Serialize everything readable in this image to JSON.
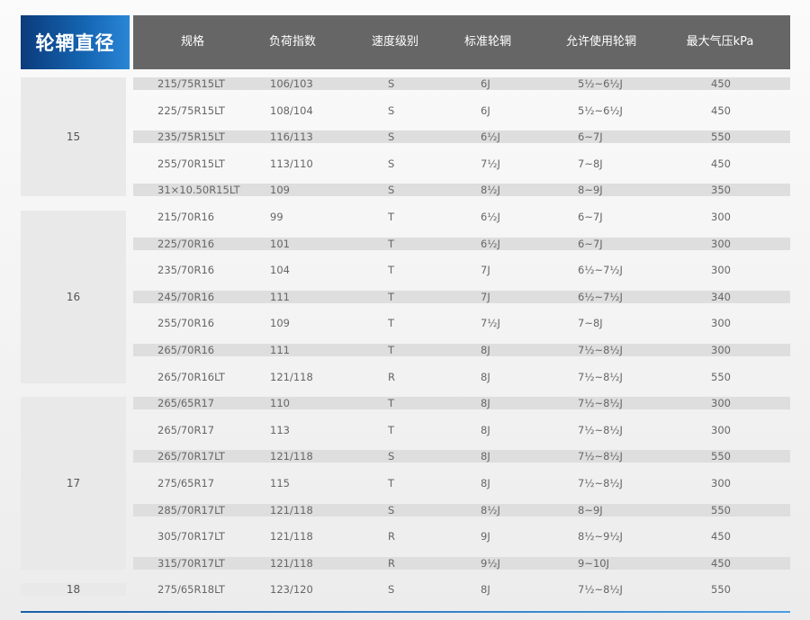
{
  "title": "轮辋直径",
  "headers": [
    "规格",
    "负荷指数",
    "速度级别",
    "标准轮辋",
    "允许使用轮辋",
    "最大气压kPa"
  ],
  "groups": [
    {
      "label": "15",
      "rows": 5
    },
    {
      "label": "16",
      "rows": 7
    },
    {
      "label": "17",
      "rows": 7
    },
    {
      "label": "18",
      "rows": 1
    }
  ],
  "rows": [
    [
      "215/75R15LT",
      "106/103",
      "S",
      "6J",
      "5½~6½J",
      "450"
    ],
    [
      "225/75R15LT",
      "108/104",
      "S",
      "6J",
      "5½~6½J",
      "450"
    ],
    [
      "235/75R15LT",
      "116/113",
      "S",
      "6½J",
      "6~7J",
      "550"
    ],
    [
      "255/70R15LT",
      "113/110",
      "S",
      "7½J",
      "7~8J",
      "450"
    ],
    [
      "31×10.50R15LT",
      "109",
      "S",
      "8½J",
      "8~9J",
      "350"
    ],
    [
      "215/70R16",
      "99",
      "T",
      "6½J",
      "6~7J",
      "300"
    ],
    [
      "225/70R16",
      "101",
      "T",
      "6½J",
      "6~7J",
      "300"
    ],
    [
      "235/70R16",
      "104",
      "T",
      "7J",
      "6½~7½J",
      "300"
    ],
    [
      "245/70R16",
      "111",
      "T",
      "7J",
      "6½~7½J",
      "340"
    ],
    [
      "255/70R16",
      "109",
      "T",
      "7½J",
      "7~8J",
      "300"
    ],
    [
      "265/70R16",
      "111",
      "T",
      "8J",
      "7½~8½J",
      "300"
    ],
    [
      "265/70R16LT",
      "121/118",
      "R",
      "8J",
      "7½~8½J",
      "550"
    ],
    [
      "265/65R17",
      "110",
      "T",
      "8J",
      "7½~8½J",
      "300"
    ],
    [
      "265/70R17",
      "113",
      "T",
      "8J",
      "7½~8½J",
      "300"
    ],
    [
      "265/70R17LT",
      "121/118",
      "S",
      "8J",
      "7½~8½J",
      "550"
    ],
    [
      "275/65R17",
      "115",
      "T",
      "8J",
      "7½~8½J",
      "300"
    ],
    [
      "285/70R17LT",
      "121/118",
      "S",
      "8½J",
      "8~9J",
      "550"
    ],
    [
      "305/70R17LT",
      "121/118",
      "R",
      "9J",
      "8½~9½J",
      "450"
    ],
    [
      "315/70R17LT",
      "121/118",
      "R",
      "9½J",
      "9~10J",
      "450"
    ],
    [
      "275/65R18LT",
      "123/120",
      "S",
      "8J",
      "7½~8½J",
      "550"
    ]
  ]
}
